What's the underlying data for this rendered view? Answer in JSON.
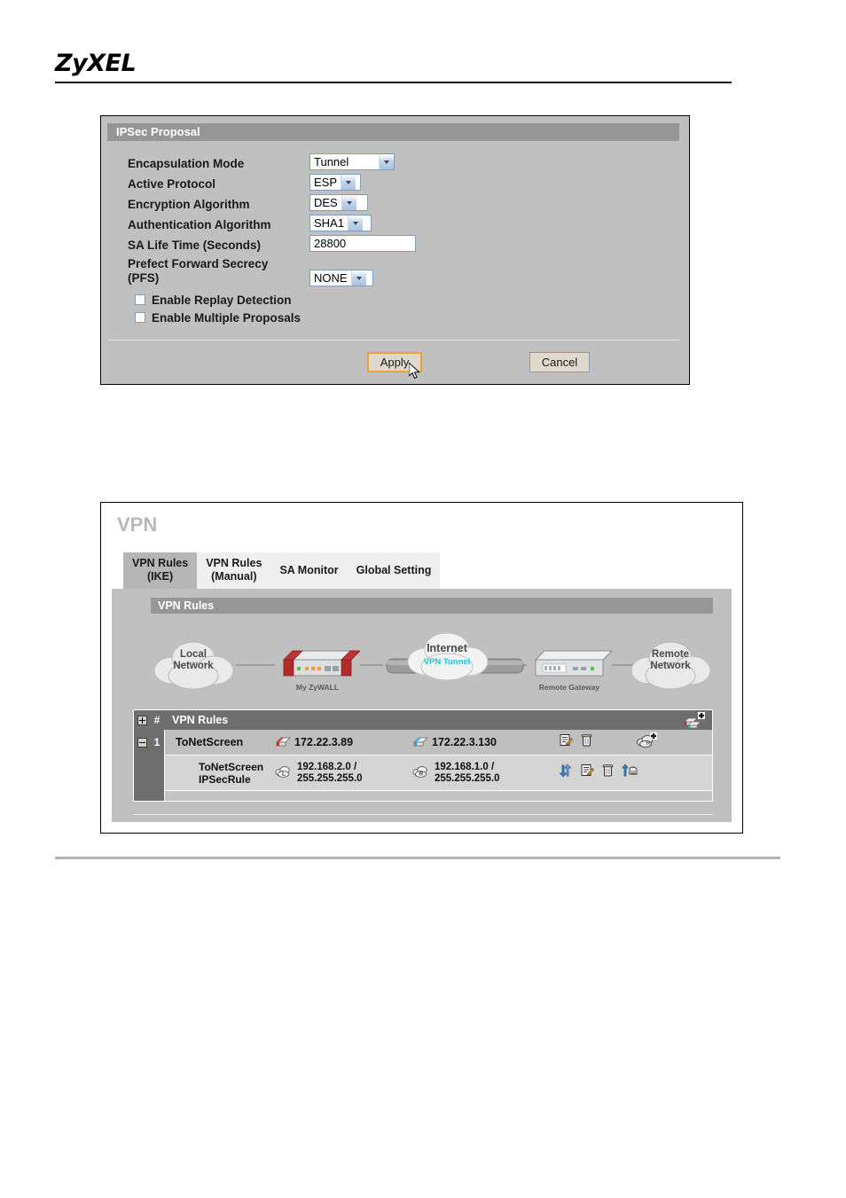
{
  "brand": {
    "logo": "ZyXEL"
  },
  "ipsec_panel": {
    "title": "IPSec Proposal",
    "fields": [
      {
        "label": "Encapsulation Mode",
        "value": "Tunnel",
        "control": "select"
      },
      {
        "label": "Active Protocol",
        "value": "ESP",
        "control": "select"
      },
      {
        "label": "Encryption Algorithm",
        "value": "DES",
        "control": "select"
      },
      {
        "label": "Authentication Algorithm",
        "value": "SHA1",
        "control": "select"
      },
      {
        "label": "SA Life Time (Seconds)",
        "value": "28800",
        "control": "text"
      },
      {
        "label": "Prefect Forward Secrecy\n(PFS)",
        "value": "NONE",
        "control": "select"
      }
    ],
    "checkboxes": [
      {
        "label": "Enable Replay Detection",
        "checked": false
      },
      {
        "label": "Enable Multiple Proposals",
        "checked": false
      }
    ],
    "buttons": {
      "apply": "Apply",
      "cancel": "Cancel"
    },
    "colors": {
      "apply_focus_border": "#e8a33d",
      "cancel_border": "#7f9db9",
      "titlebar": "#969696",
      "panel_bg": "#c0c0c0"
    }
  },
  "vpn_panel": {
    "page_title": "VPN",
    "tabs": [
      {
        "label": "VPN Rules\n(IKE)",
        "active": true
      },
      {
        "label": "VPN Rules\n(Manual)",
        "active": false
      },
      {
        "label": "SA Monitor",
        "active": false
      },
      {
        "label": "Global Setting",
        "active": false
      }
    ],
    "section_title": "VPN Rules",
    "diagram": {
      "local_cloud": "Local\nNetwork",
      "local_device": "My ZyWALL",
      "internet_cloud": "Internet",
      "tunnel_label": "VPN Tunnel",
      "remote_device": "Remote Gateway",
      "remote_cloud": "Remote\nNetwork",
      "tunnel_color": "#18c8d8"
    },
    "rules_table": {
      "header": {
        "index_label": "#",
        "title": "VPN Rules",
        "add_icon": "add-gateway-icon"
      },
      "rows": [
        {
          "index": "1",
          "name": "ToNetScreen",
          "local_icon": "local-gateway-icon",
          "local_address": "172.22.3.89",
          "remote_icon": "remote-gateway-icon",
          "remote_address": "172.22.3.130",
          "icons": [
            "edit-icon",
            "delete-icon",
            "add-policy-icon"
          ],
          "sub_rows": [
            {
              "name": "ToNetScreen\nIPSecRule",
              "local_icon": "local-network-cloud-icon",
              "local_address": "192.168.2.0 /\n255.255.255.0",
              "remote_icon": "remote-network-cloud-icon",
              "remote_address": "192.168.1.0 /\n255.255.255.0",
              "icons": [
                "move-updown-icon",
                "edit-icon",
                "delete-icon",
                "dial-icon"
              ]
            }
          ]
        }
      ]
    }
  }
}
